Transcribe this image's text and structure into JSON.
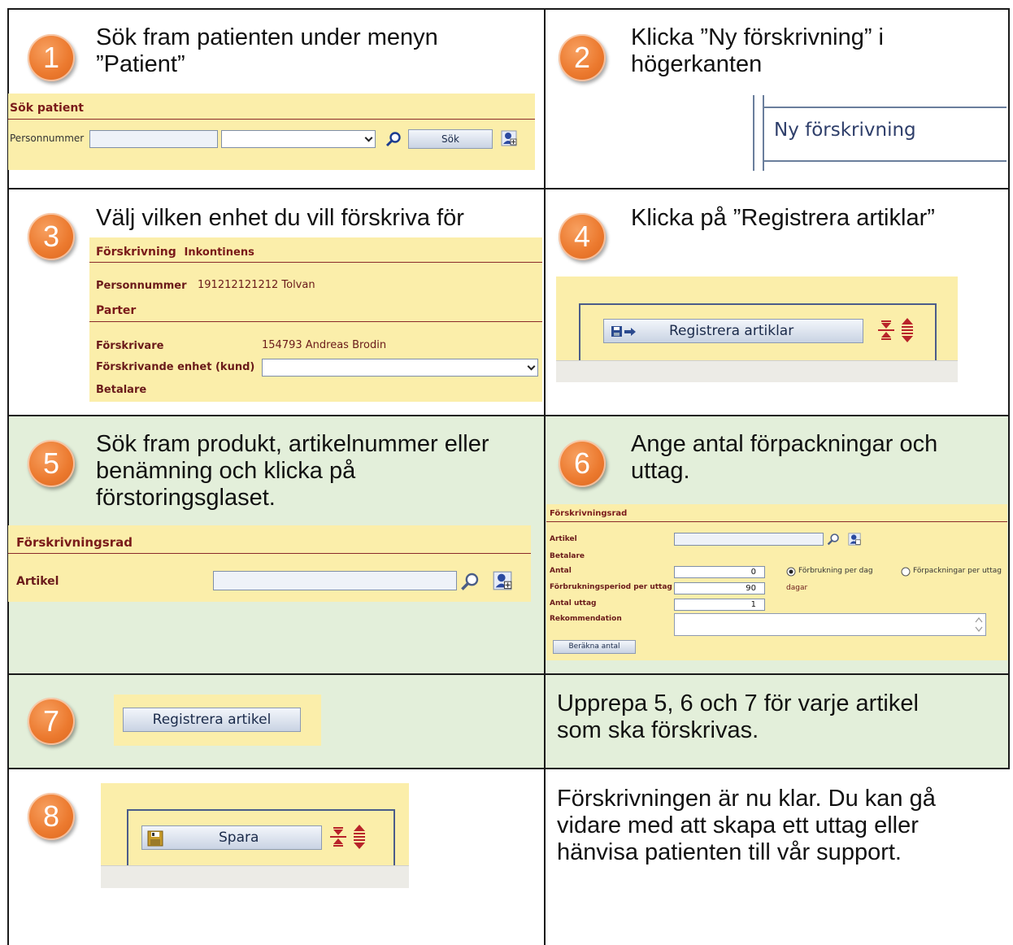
{
  "steps": [
    {
      "number": "1",
      "text": "Sök fram patienten under menyn\n ”Patient”"
    },
    {
      "number": "2",
      "text": "Klicka ”Ny förskrivning” i\n högerkanten"
    },
    {
      "number": "3",
      "text": "Välj vilken enhet du vill förskriva för"
    },
    {
      "number": "4",
      "text": "Klicka på ”Registrera artiklar”"
    },
    {
      "number": "5",
      "text": "Sök fram produkt, artikelnummer eller\n benämning och klicka på\n förstoringsglaset."
    },
    {
      "number": "6",
      "text": "Ange antal förpackningar och\n uttag."
    },
    {
      "number": "7",
      "text": ""
    },
    {
      "number": "8",
      "text": ""
    }
  ],
  "step7_note": "Upprepa 5, 6 och 7 för varje artikel\nsom ska förskrivas.",
  "step8_note": "Förskrivningen är nu klar. Du kan gå\nvidare med att skapa ett uttag eller\nhänvisa patienten till vår support.",
  "sok_patient": {
    "title": "Sök patient",
    "personnummer_label": "Personnummer",
    "personnummer_value": "",
    "select_value": "",
    "sok_button": "Sök"
  },
  "menu": {
    "ny_forskrivning": "Ny förskrivning"
  },
  "forskrivning": {
    "title": "Förskrivning",
    "title_sub": "Inkontinens",
    "personnummer_label": "Personnummer",
    "personnummer_value": "191212121212 Tolvan",
    "parter": "Parter",
    "forskrivare_label": "Förskrivare",
    "forskrivare_value": "154793 Andreas Brodin",
    "enhet_label": "Förskrivande enhet (kund)",
    "enhet_value": "",
    "betalare_label": "Betalare"
  },
  "registrera_artiklar": {
    "button": "Registrera artiklar"
  },
  "forskrivningsrad_5": {
    "title": "Förskrivningsrad",
    "artikel_label": "Artikel",
    "artikel_value": ""
  },
  "forskrivningsrad_6": {
    "title": "Förskrivningsrad",
    "artikel_label": "Artikel",
    "betalare_label": "Betalare",
    "antal_label": "Antal",
    "antal_value": "0",
    "period_label": "Förbrukningsperiod per uttag",
    "period_value": "90",
    "period_unit": "dagar",
    "antal_uttag_label": "Antal uttag",
    "antal_uttag_value": "1",
    "rekommendation_label": "Rekommendation",
    "radio1": "Förbrukning per dag",
    "radio2": "Förpackningar per uttag",
    "berakna_button": "Beräkna antal"
  },
  "registrera_artikel": {
    "button": "Registrera artikel"
  },
  "spara": {
    "button": "Spara"
  }
}
